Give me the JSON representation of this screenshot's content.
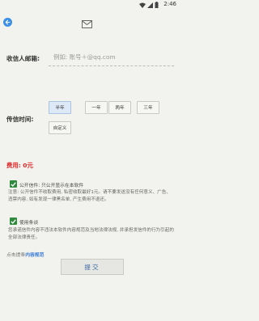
{
  "status_bar": {
    "time": "2:46"
  },
  "recipient": {
    "label": "收信人邮箱:",
    "placeholder": "例如: 账号＋@qq.com"
  },
  "send_time": {
    "label": "传信时间:",
    "options": [
      "半年",
      "一年",
      "两年",
      "三年",
      "自定义"
    ],
    "selected": "半年"
  },
  "fee": "费用: 0元",
  "public_letter": {
    "checked": true,
    "label": "公开信件: 只公开显示在本软件",
    "notice": "注意: 公开信件不收取费用, 私密收取最好1元。请不要发送没有任何意义、广告、违禁内容, 如有发现一律黑名单, 产生费用不退还。"
  },
  "legal": {
    "checked": true,
    "label": "使用条谈",
    "notice": "您承诺信件内容不违法本软件内容规范及当地法律法规, 并承担发信件的行为引起的全部法律责任。"
  },
  "agreement": {
    "prefix": "点击提奉",
    "link": "内容规范"
  },
  "submit_label": "提交",
  "colors": {
    "accent": "#3a8ee6",
    "checkbox": "#2e8b3e",
    "fee": "#e02828",
    "link": "#3a7bd5"
  }
}
